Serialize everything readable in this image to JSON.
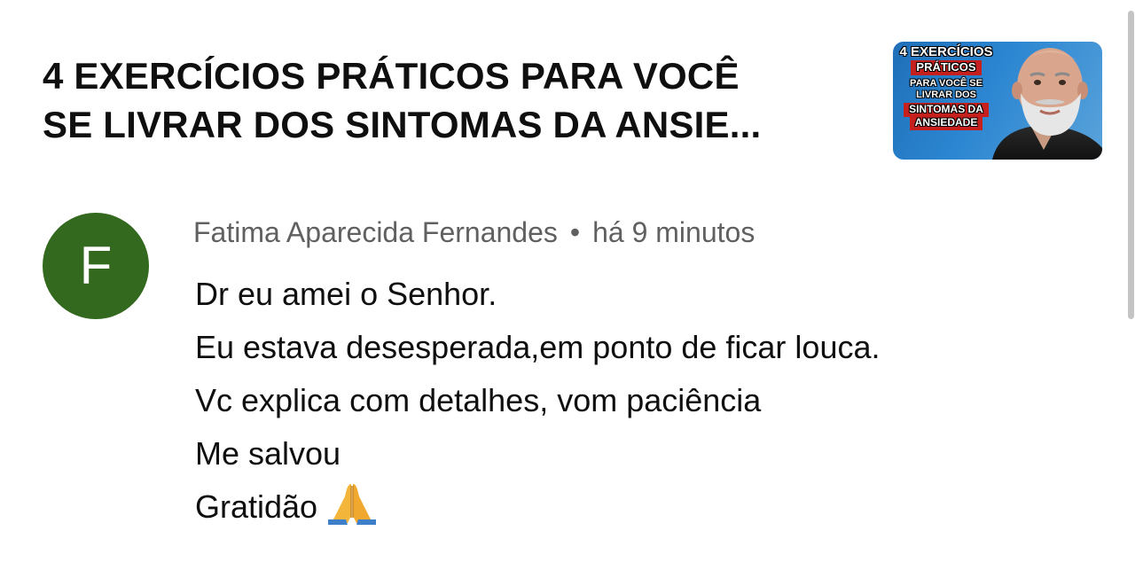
{
  "video": {
    "title_line1": "4 EXERCÍCIOS PRÁTICOS PARA VOCÊ",
    "title_line2": "SE LIVRAR DOS SINTOMAS DA ANSIE...",
    "thumbnail": {
      "line1": "4 EXERCÍCIOS",
      "line2": "PRÁTICOS",
      "line3": "PARA VOCÊ SE",
      "line4": "LIVRAR DOS",
      "line5": "SINTOMAS DA",
      "line6": "ANSIEDADE",
      "background_color": "#2c86d1",
      "highlight_color": "#c6201e"
    }
  },
  "comment": {
    "avatar_letter": "F",
    "avatar_color": "#33691e",
    "author": "Fatima Aparecida Fernandes",
    "separator": "•",
    "time": "há 9 minutos",
    "lines": [
      "Dr eu amei o Senhor.",
      "Eu estava desesperada,em ponto de ficar louca.",
      "Vc explica com detalhes, vom paciência",
      "Me salvou",
      "Gratidão"
    ],
    "emoji": "folded-hands-icon"
  }
}
